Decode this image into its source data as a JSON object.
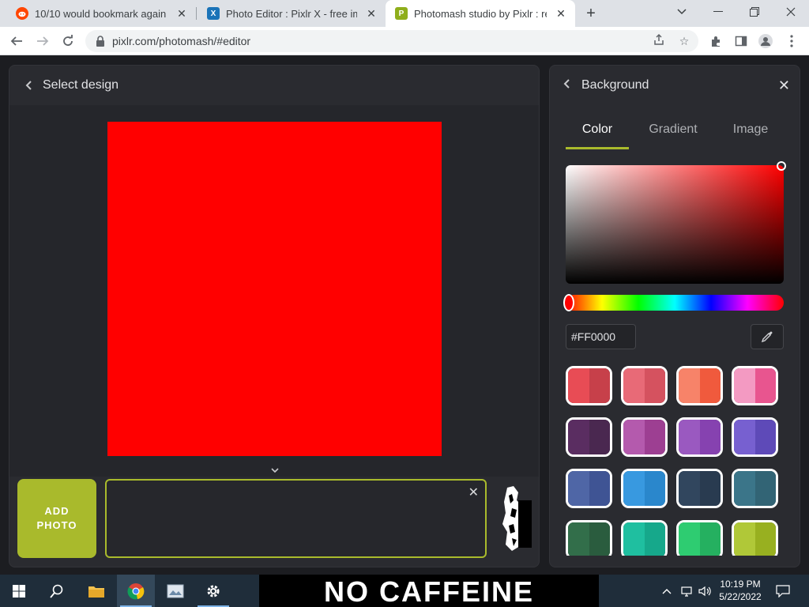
{
  "browser": {
    "tabs": [
      {
        "title": "10/10 would bookmark again",
        "favicon": "reddit-icon",
        "color": "#ff4500"
      },
      {
        "title": "Photo Editor : Pixlr X - free image",
        "favicon": "pixlr-x-icon",
        "color": "#1a73b8"
      },
      {
        "title": "Photomash studio by Pixlr : remo",
        "favicon": "photomash-icon",
        "color": "#8fae1b",
        "active": true
      }
    ],
    "new_tab_label": "+",
    "url": "pixlr.com/photomash/#editor"
  },
  "editor": {
    "header_label": "Select design",
    "canvas_color": "#FF0000",
    "add_photo_label_line1": "ADD",
    "add_photo_label_line2": "PHOTO",
    "accent": "#a9ba2c"
  },
  "panel": {
    "title": "Background",
    "tabs": [
      {
        "label": "Color",
        "active": true
      },
      {
        "label": "Gradient",
        "active": false
      },
      {
        "label": "Image",
        "active": false
      }
    ],
    "hex_value": "#FF0000",
    "swatches": [
      [
        "#e84c55",
        "#c7404a"
      ],
      [
        "#e86a77",
        "#d5525f"
      ],
      [
        "#f78369",
        "#f05a3d"
      ],
      [
        "#f39ac2",
        "#e8558f"
      ],
      [
        "#5a2d61",
        "#4a2850"
      ],
      [
        "#b45aad",
        "#9d3f92"
      ],
      [
        "#9a59c0",
        "#8642b0"
      ],
      [
        "#7760d0",
        "#5e4ab8"
      ],
      [
        "#4f66a6",
        "#3f5494"
      ],
      [
        "#3899e0",
        "#2a87cc"
      ],
      [
        "#31465e",
        "#293b50"
      ],
      [
        "#3b7589",
        "#326475"
      ],
      [
        "#326e4a",
        "#2a5c3e"
      ],
      [
        "#1fbfa0",
        "#16a88b"
      ],
      [
        "#2ecc71",
        "#25b060"
      ],
      [
        "#b0c838",
        "#98b020"
      ]
    ]
  },
  "taskbar": {
    "banner_text": "NO CAFFEINE",
    "time": "10:19 PM",
    "date": "5/22/2022"
  }
}
